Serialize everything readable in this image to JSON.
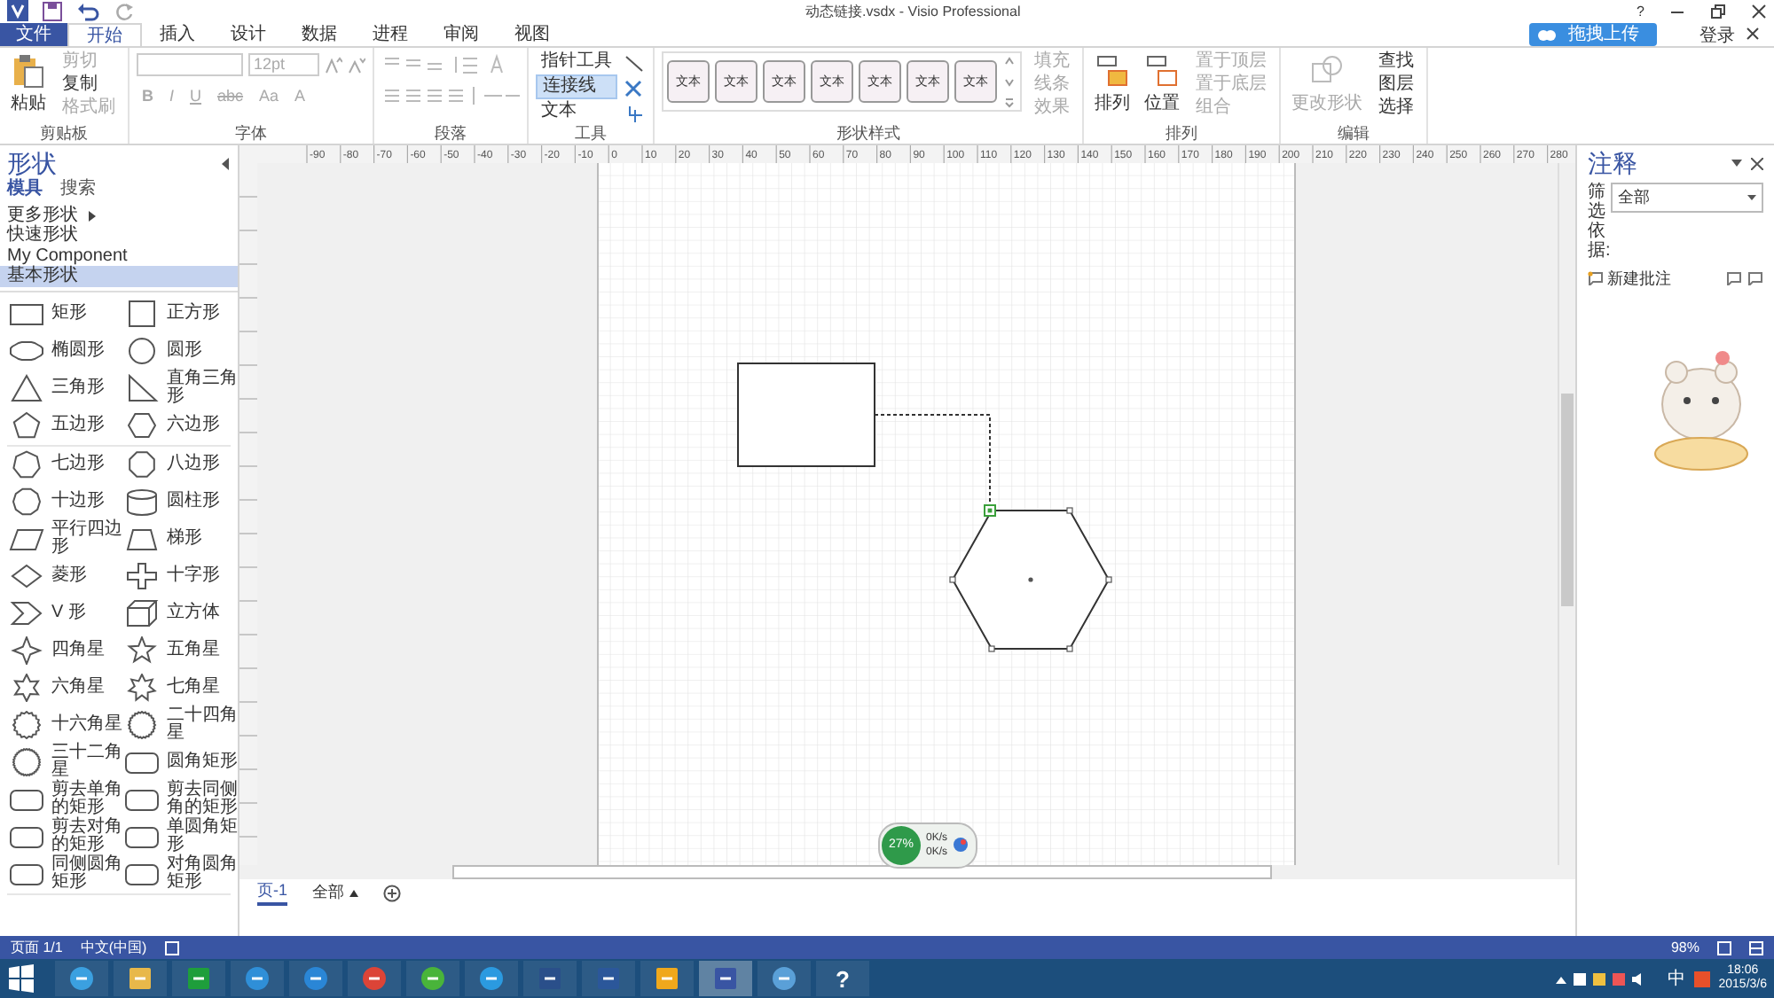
{
  "window": {
    "title": "动态链接.vsdx - Visio Professional",
    "help": "?"
  },
  "tabs": [
    {
      "label": "文件",
      "kind": "file",
      "selected": false
    },
    {
      "label": "开始",
      "kind": "tab",
      "selected": true
    },
    {
      "label": "插入",
      "kind": "tab",
      "selected": false
    },
    {
      "label": "设计",
      "kind": "tab",
      "selected": false
    },
    {
      "label": "数据",
      "kind": "tab",
      "selected": false
    },
    {
      "label": "进程",
      "kind": "tab",
      "selected": false
    },
    {
      "label": "审阅",
      "kind": "tab",
      "selected": false
    },
    {
      "label": "视图",
      "kind": "tab",
      "selected": false
    }
  ],
  "account": {
    "upload": "拖拽上传",
    "login": "登录"
  },
  "ribbon": [
    {
      "kind": "clipboard",
      "label": "剪贴板",
      "big": "粘贴",
      "items": [
        {
          "label": "剪切",
          "disabled": true
        },
        {
          "label": "复制",
          "disabled": false
        },
        {
          "label": "格式刷",
          "disabled": true
        }
      ]
    },
    {
      "kind": "font",
      "label": "字体",
      "size": "12pt",
      "buttons": [
        "B",
        "I",
        "U",
        "abc",
        "Aa",
        "A"
      ]
    },
    {
      "kind": "paragraph",
      "label": "段落"
    },
    {
      "kind": "tools",
      "label": "工具",
      "items": [
        {
          "label": "指针工具",
          "selected": false
        },
        {
          "label": "连接线",
          "selected": true
        },
        {
          "label": "文本",
          "selected": false
        }
      ]
    },
    {
      "kind": "styles",
      "label": "形状样式",
      "swatches": [
        "文本",
        "文本",
        "文本",
        "文本",
        "文本",
        "文本",
        "文本"
      ],
      "items": [
        "填充",
        "线条",
        "效果"
      ]
    },
    {
      "kind": "arrange",
      "label": "排列",
      "big": [
        "排列",
        "位置"
      ],
      "items": [
        "置于顶层",
        "置于底层",
        "组合"
      ]
    },
    {
      "kind": "editing",
      "label": "编辑",
      "big": "更改形状",
      "items": [
        "查找",
        "图层",
        "选择"
      ]
    }
  ],
  "shapes_panel": {
    "title": "形状",
    "tabs": [
      {
        "label": "模具",
        "selected": true
      },
      {
        "label": "搜索",
        "selected": false
      }
    ],
    "stencils": [
      {
        "label": "更多形状",
        "kind": "menu",
        "selected": false
      },
      {
        "label": "快速形状",
        "kind": "stencil",
        "selected": false
      },
      {
        "label": "My Component",
        "kind": "stencil",
        "selected": false
      },
      {
        "label": "基本形状",
        "kind": "stencil",
        "selected": true
      }
    ],
    "groups": [
      [
        {
          "label": "矩形",
          "kind": "rect"
        },
        {
          "label": "正方形",
          "kind": "square"
        },
        {
          "label": "椭圆形",
          "kind": "ellipse"
        },
        {
          "label": "圆形",
          "kind": "circle"
        },
        {
          "label": "三角形",
          "kind": "triangle"
        },
        {
          "label": "直角三角形",
          "kind": "right-triangle"
        },
        {
          "label": "五边形",
          "kind": "pentagon"
        },
        {
          "label": "六边形",
          "kind": "hexagon"
        }
      ],
      [
        {
          "label": "七边形",
          "kind": "heptagon"
        },
        {
          "label": "八边形",
          "kind": "octagon"
        },
        {
          "label": "十边形",
          "kind": "decagon"
        },
        {
          "label": "圆柱形",
          "kind": "cylinder"
        },
        {
          "label": "平行四边形",
          "kind": "parallelogram"
        },
        {
          "label": "梯形",
          "kind": "trapezoid"
        },
        {
          "label": "菱形",
          "kind": "diamond"
        },
        {
          "label": "十字形",
          "kind": "cross"
        },
        {
          "label": "V 形",
          "kind": "chevron"
        },
        {
          "label": "立方体",
          "kind": "cube"
        },
        {
          "label": "四角星",
          "kind": "star4"
        },
        {
          "label": "五角星",
          "kind": "star5"
        },
        {
          "label": "六角星",
          "kind": "star6"
        },
        {
          "label": "七角星",
          "kind": "star7"
        },
        {
          "label": "十六角星",
          "kind": "star16"
        },
        {
          "label": "二十四角星",
          "kind": "star24"
        },
        {
          "label": "三十二角星",
          "kind": "star32"
        },
        {
          "label": "圆角矩形",
          "kind": "rounded"
        },
        {
          "label": "剪去单角的矩形",
          "kind": "rounded"
        },
        {
          "label": "剪去同侧角的矩形",
          "kind": "rounded"
        },
        {
          "label": "剪去对角的矩形",
          "kind": "rounded"
        },
        {
          "label": "单圆角矩形",
          "kind": "rounded"
        },
        {
          "label": "同侧圆角矩形",
          "kind": "rounded"
        },
        {
          "label": "对角圆角矩形",
          "kind": "rounded"
        }
      ]
    ]
  },
  "ruler": {
    "labels": [
      "-90",
      "-80",
      "-70",
      "-60",
      "-50",
      "-40",
      "-30",
      "-20",
      "-10",
      "0",
      "10",
      "20",
      "30",
      "40",
      "50",
      "60",
      "70",
      "80",
      "90",
      "100",
      "110",
      "120",
      "130",
      "140",
      "150",
      "160",
      "170",
      "180",
      "190",
      "200",
      "210",
      "220",
      "230",
      "240",
      "250",
      "260",
      "270",
      "280"
    ]
  },
  "diagram": {
    "shapes": [
      {
        "kind": "rectangle",
        "selected": false
      },
      {
        "kind": "hexagon",
        "selected": true
      }
    ],
    "connector": {
      "kind": "dashed"
    }
  },
  "net_widget": {
    "percent": "27%",
    "up": "0K/s",
    "down": "0K/s"
  },
  "pages": {
    "tabs": [
      {
        "label": "页-1",
        "selected": true
      }
    ],
    "all": "全部"
  },
  "notes_panel": {
    "title": "注释",
    "filter_label": "筛选依据:",
    "filter_value": "全部",
    "new_note": "新建批注"
  },
  "status_bar": {
    "page": "页面 1/1",
    "language": "中文(中国)",
    "zoom": "98%"
  },
  "taskbar": {
    "apps": [
      {
        "kind": "ie",
        "active": false
      },
      {
        "kind": "explorer",
        "active": false
      },
      {
        "kind": "store",
        "active": false
      },
      {
        "kind": "cloud",
        "active": false
      },
      {
        "kind": "baidu-cloud",
        "active": false
      },
      {
        "kind": "chrome",
        "active": false
      },
      {
        "kind": "green-browser",
        "active": false
      },
      {
        "kind": "swirl-browser",
        "active": false
      },
      {
        "kind": "media",
        "active": false
      },
      {
        "kind": "word",
        "active": false
      },
      {
        "kind": "yellow-app",
        "active": false
      },
      {
        "kind": "visio",
        "active": true
      },
      {
        "kind": "people",
        "active": false
      },
      {
        "kind": "help",
        "active": false,
        "glyph": "?"
      }
    ],
    "ime": "中",
    "time": "18:06",
    "date": "2015/3/6"
  }
}
